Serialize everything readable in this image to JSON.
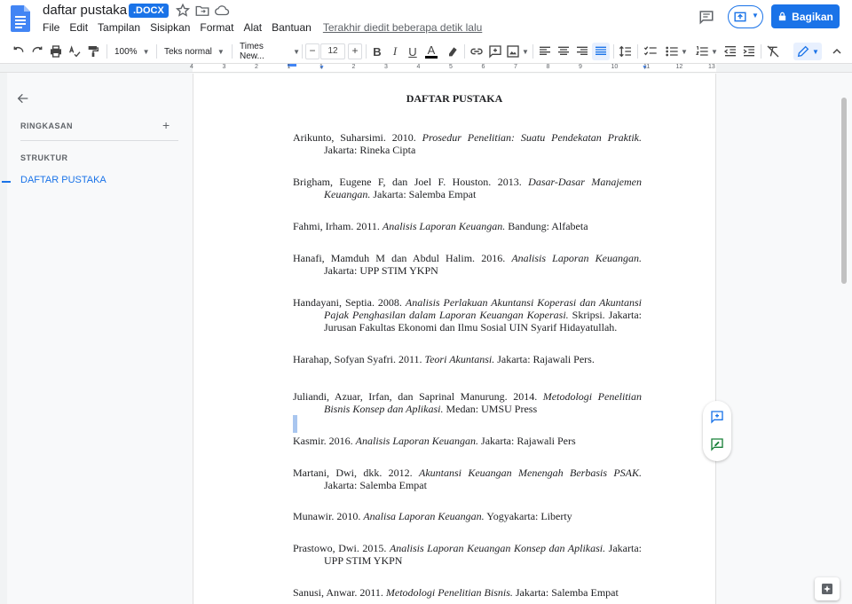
{
  "header": {
    "title": "daftar pustaka",
    "badge": ".DOCX",
    "menu": [
      "File",
      "Edit",
      "Tampilan",
      "Sisipkan",
      "Format",
      "Alat",
      "Bantuan"
    ],
    "last_edit": "Terakhir diedit beberapa detik lalu",
    "share_label": "Bagikan"
  },
  "toolbar": {
    "zoom": "100%",
    "style": "Teks normal",
    "font": "Times New...",
    "font_size": "12",
    "minus": "−",
    "plus": "+",
    "bold": "B",
    "italic": "I",
    "underline": "U",
    "text_color": "A"
  },
  "ruler": {
    "ticks": [
      "4",
      "3",
      "2",
      "1",
      "1",
      "2",
      "3",
      "4",
      "5",
      "6",
      "7",
      "8",
      "9",
      "10",
      "11",
      "12",
      "13",
      "14",
      "15",
      "16",
      "17"
    ]
  },
  "outline": {
    "summary_label": "RINGKASAN",
    "add": "+",
    "structure_label": "STRUKTUR",
    "item": "DAFTAR PUSTAKA"
  },
  "document": {
    "title": "DAFTAR PUSTAKA",
    "references": [
      {
        "pre": "Arikunto, Suharsimi. 2010. ",
        "it": "Prosedur Penelitian: Suatu Pendekatan Praktik.",
        "post": " Jakarta: Rineka Cipta"
      },
      {
        "pre": "Brigham, Eugene F, dan Joel F. Houston. 2013. ",
        "it": "Dasar-Dasar Manajemen Keuangan.",
        "post": " Jakarta: Salemba Empat"
      },
      {
        "pre": "Fahmi, Irham. 2011. ",
        "it": "Analisis Laporan Keuangan.",
        "post": " Bandung: Alfabeta"
      },
      {
        "pre": "Hanafi, Mamduh M dan Abdul Halim. 2016. ",
        "it": "Analisis Laporan Keuangan.",
        "post": " Jakarta: UPP STIM YKPN"
      },
      {
        "pre": "Handayani, Septia. 2008. ",
        "it": "Analisis Perlakuan Akuntansi Koperasi dan Akuntansi Pajak Penghasilan dalam Laporan Keuangan Koperasi.",
        "post": " Skripsi. Jakarta: Jurusan Fakultas Ekonomi dan Ilmu Sosial UIN Syarif Hidayatullah."
      },
      {
        "pre": "Harahap, Sofyan Syafri. 2011. ",
        "it": "Teori Akuntansi.",
        "post": " Jakarta: Rajawali Pers."
      },
      {
        "pre": "Juliandi, Azuar, Irfan, dan Saprinal Manurung. 2014. ",
        "it": "Metodologi Penelitian Bisnis Konsep dan Aplikasi.",
        "post": " Medan: UMSU Press"
      },
      {
        "pre": "Kasmir. 2016. ",
        "it": "Analisis Laporan Keuangan.",
        "post": " Jakarta: Rajawali Pers"
      },
      {
        "pre": "Martani, Dwi, dkk. 2012. ",
        "it": "Akuntansi Keuangan Menengah Berbasis PSAK.",
        "post": " Jakarta: Salemba Empat"
      },
      {
        "pre": "Munawir. 2010. ",
        "it": "Analisa Laporan Keuangan.",
        "post": " Yogyakarta: Liberty"
      },
      {
        "pre": "Prastowo, Dwi. 2015. ",
        "it": "Analisis Laporan Keuangan Konsep dan Aplikasi.",
        "post": " Jakarta: UPP STIM YKPN"
      },
      {
        "pre": "Sanusi, Anwar. 2011. ",
        "it": "Metodologi Penelitian Bisnis.",
        "post": " Jakarta: Salemba Empat"
      }
    ]
  },
  "colors": {
    "accent": "#1a73e8",
    "doc_icon": "#4285f4"
  }
}
